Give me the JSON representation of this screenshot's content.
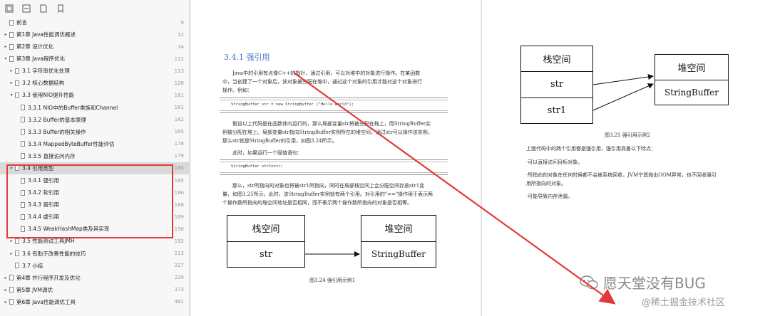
{
  "sidebar": {
    "toolbar_icons": [
      "grid-view-icon",
      "collapse-icon",
      "file-icon",
      "bookmark-icon"
    ],
    "items": [
      {
        "label": "前言",
        "page": "9",
        "caret": "",
        "indent": 0
      },
      {
        "label": "第1章 Java性能调优概述",
        "page": "12",
        "caret": "▸",
        "indent": 0
      },
      {
        "label": "第2章 设计优化",
        "page": "34",
        "caret": "▸",
        "indent": 0
      },
      {
        "label": "第3章 Java程序优化",
        "page": "112",
        "caret": "▾",
        "indent": 0
      },
      {
        "label": "3.1 字符串优化处理",
        "page": "113",
        "caret": "▸",
        "indent": 1
      },
      {
        "label": "3.2 核心数据结构",
        "page": "128",
        "caret": "▸",
        "indent": 1
      },
      {
        "label": "3.3 使用NIO提升性能",
        "page": "161",
        "caret": "▾",
        "indent": 1
      },
      {
        "label": "3.3.1 NIO中的Buffer类族和Channel",
        "page": "161",
        "caret": "",
        "indent": 2
      },
      {
        "label": "3.3.2 Buffer的基本原理",
        "page": "162",
        "caret": "",
        "indent": 2
      },
      {
        "label": "3.3.3 Buffer的相关操作",
        "page": "165",
        "caret": "",
        "indent": 2
      },
      {
        "label": "3.3.4 MappedByteBuffer性能评估",
        "page": "178",
        "caret": "",
        "indent": 2
      },
      {
        "label": "3.3.5 直接访问内存",
        "page": "179",
        "caret": "",
        "indent": 2
      },
      {
        "label": "3.4 引用类型",
        "page": "184",
        "caret": "▾",
        "indent": 1,
        "selected": true
      },
      {
        "label": "3.4.1 强引用",
        "page": "185",
        "caret": "",
        "indent": 2
      },
      {
        "label": "3.4.2 软引用",
        "page": "186",
        "caret": "",
        "indent": 2
      },
      {
        "label": "3.4.3 弱引用",
        "page": "188",
        "caret": "",
        "indent": 2
      },
      {
        "label": "3.4.4 虚引用",
        "page": "189",
        "caret": "",
        "indent": 2
      },
      {
        "label": "3.4.5 WeakHashMap类及其实现",
        "page": "190",
        "caret": "",
        "indent": 2
      },
      {
        "label": "3.5 性能测试工具JMH",
        "page": "192",
        "caret": "▸",
        "indent": 1
      },
      {
        "label": "3.6 有助于改善性能的技巧",
        "page": "213",
        "caret": "▸",
        "indent": 1
      },
      {
        "label": "3.7 小结",
        "page": "227",
        "caret": "",
        "indent": 1
      },
      {
        "label": "第4章 并行程序开发及优化",
        "page": "229",
        "caret": "▸",
        "indent": 0
      },
      {
        "label": "第5章 JVM调优",
        "page": "373",
        "caret": "▸",
        "indent": 0
      },
      {
        "label": "第6章 Java性能调优工具",
        "page": "481",
        "caret": "▸",
        "indent": 0
      }
    ]
  },
  "page_left": {
    "section_title": "3.4.1   强引用",
    "para1_l1": "Java中的引用有点像C++的指针，通过引用，可以对堆中的对象进行操作。在某函数",
    "para1_l2": "中，当创建了一个对象后，该对象被分配在堆中，通过这个对象的引用才能对这个对象进行",
    "para1_l3": "操作。例如：",
    "code1": "StringBuffer str = new StringBuffer (\"Hello world\");",
    "para2_l1": "假设以上代码是在函数体内运行的，那么局部变量str将被分配在栈上，而StringBuffer实",
    "para2_l2": "例被分配在堆上。局部变量str指向StringBuffer实例所在的堆空间，通过str可以操作该实例，",
    "para2_l3": "那么str就是StringBuffer的引用，如图3.24所示。",
    "para3": "此时，如果运行一个赋值语句：",
    "code2": "StringBuffer str1=str;",
    "para4_l1": "那么，str所指向的对象也将被str1所指向，同时在局部栈空间上会分配空间存放str1变",
    "para4_l2": "量，如图3.25所示。此时，该StringBuffer实例就有两个引用。对引用的\"==\"操作用于表示两",
    "para4_l3": "个操作数所指向的堆空间地址是否相同，而不表示两个操作数所指向的对象是否相等。",
    "fig": {
      "stack_title": "栈空间",
      "stack_var": "str",
      "heap_title": "堆空间",
      "heap_obj": "StringBuffer",
      "caption": "图3.24    强引用示例1"
    }
  },
  "page_right": {
    "fig": {
      "stack_title": "栈空间",
      "var1": "str",
      "var2": "str1",
      "heap_title": "堆空间",
      "heap_obj": "StringBuffer",
      "caption": "图3.25    强引用示例2"
    },
    "intro": "上面代码中的两个引用都是强引用，强引用具备以下特点：",
    "bullet1": "·可以直接访问目标对象。",
    "bullet2_l1": "·所指向的对象在任何时候都不会被系统回收，JVM宁愿抛出OOM异常，也不回收强引",
    "bullet2_l2": "用所指向的对象。",
    "bullet3": "·可能导致内存泄漏。"
  },
  "watermarks": {
    "wechat": "愿天堂没有BUG",
    "site": "@稀土掘金技术社区"
  },
  "colors": {
    "annotation_red": "#e23a3a",
    "section_blue": "#3b7cc4"
  }
}
